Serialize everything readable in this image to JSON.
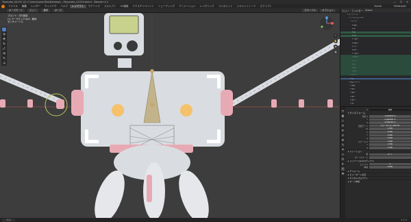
{
  "window": {
    "title": "Toyarobo_0415V (2) C:\\Users\\yoshiSta\\Desktop\\...\\Toyarobo_0415V.blend - Blender 4.1",
    "controls": [
      "—",
      "☐",
      "✕"
    ]
  },
  "menubar": {
    "items": [
      "ファイル",
      "編集",
      "レンダー",
      "ウィンドウ",
      "ヘルプ"
    ],
    "workspaces": [
      "レイアウト",
      "モデリング",
      "スカルプト",
      "UV編集",
      "テクスチャペイント",
      "シェーディング",
      "アニメーション",
      "レンダリング",
      "コンポジット",
      "ジオメトリノード",
      "スクリプト"
    ],
    "active_workspace": "レイアウト",
    "scene_label": "Scene",
    "view_layer_label": "ViewLayer"
  },
  "viewport_header": {
    "mode": "ポーズモード",
    "view": "ビュー",
    "select": "選択",
    "pose": "ポーズ",
    "transform": "グローバル",
    "options": "オプション"
  },
  "viewport": {
    "overlay_lines": [
      "フロント・平行投影",
      "(1) アーマチュア.003 : 胴体",
      "センチメートル"
    ],
    "bg_color": "#3d3d3d",
    "axis_color": "#c0564f",
    "robot": {
      "body_color": "#d9dce0",
      "accent_color": "#e7aab4",
      "eye_color": "#f5c16a",
      "screen_color": "#c8d28c"
    }
  },
  "toolbar": {
    "tools": [
      "select",
      "cursor",
      "move",
      "rotate",
      "scale",
      "transform",
      "annotate",
      "measure"
    ],
    "active_tool": "select"
  },
  "nav_icons": [
    "zoom",
    "pan",
    "camera",
    "perspective"
  ],
  "statusbar": {
    "left": "ペル",
    "version": "4.1.0"
  },
  "outliner": {
    "header": [
      "ビュー",
      "フィルター",
      "Scene"
    ],
    "rows": [
      "▾ コレクション",
      "  ▾ アーマチュア.003",
      "    ▾ ポーズ",
      "      ▸ 胴体",
      "      ▸ 首",
      "      ▸ 頭",
      "      ▸ 肩.L",
      "      ▸ 上腕.L",
      "      ▸ 前腕.L",
      "      ▸ 手.L",
      "      ▸ 肩.R",
      "      ▸ 上腕.R",
      "      ▸ 前腕.R",
      "      ▸ 手.R",
      "      ▸ 腰",
      "      ▸ 脚.L",
      "      ▸ 脚.R",
      "    ▸ ボディ",
      "    ▸ 目",
      "  ▾ 頂点グループ",
      "    ▸ 胴体",
      "    ▸ 腕.L",
      "    ▸ 腕.R",
      "    ▸ 脚.L",
      "    ▸ 脚.R",
      "    ▸ 頭"
    ],
    "highlight_rows": [
      5,
      6
    ],
    "selected_rows": [
      18
    ]
  },
  "properties": {
    "tabs": [
      "tool",
      "render",
      "output",
      "view",
      "scene",
      "world",
      "object",
      "modifier",
      "particle",
      "physics",
      "constraint",
      "data",
      "bone",
      "material"
    ],
    "active_tab": "bone",
    "bone_name": "胴体",
    "sections": {
      "transform": {
        "title": "トランスフォーム",
        "rows": [
          {
            "label": "位置 X",
            "value": "-0.000000 m"
          },
          {
            "label": "Y",
            "value": "0.000000 m"
          },
          {
            "label": "Z",
            "value": "0.000000 m"
          },
          {
            "label": "回転モード",
            "value": "クォータニオン(WXYZ)"
          },
          {
            "label": "W",
            "value": "1.000"
          },
          {
            "label": "X",
            "value": "0.000"
          },
          {
            "label": "Y",
            "value": "0.000"
          },
          {
            "label": "Z",
            "value": "0.000"
          },
          {
            "label": "スケール X",
            "value": "1.000"
          },
          {
            "label": "Y",
            "value": "1.000"
          },
          {
            "label": "Z",
            "value": "1.000"
          }
        ]
      },
      "relations": {
        "title": "▸ リレーション",
        "rows": [
          {
            "label": "親",
            "value": "ルート"
          },
          {
            "label": "ボーングループ",
            "value": ""
          }
        ]
      },
      "inverse": {
        "title": "▸ インバースキネマティクス",
        "rows": [
          {
            "label": "ロック X",
            "value": "0"
          },
          {
            "label": "伸縮",
            "value": "0.000"
          }
        ]
      },
      "collapsed": [
        "▸ デフォーム",
        "▸ ビューポート表示",
        "▸ カスタムプロパティ",
        "▸ ボーン拘束"
      ]
    }
  }
}
